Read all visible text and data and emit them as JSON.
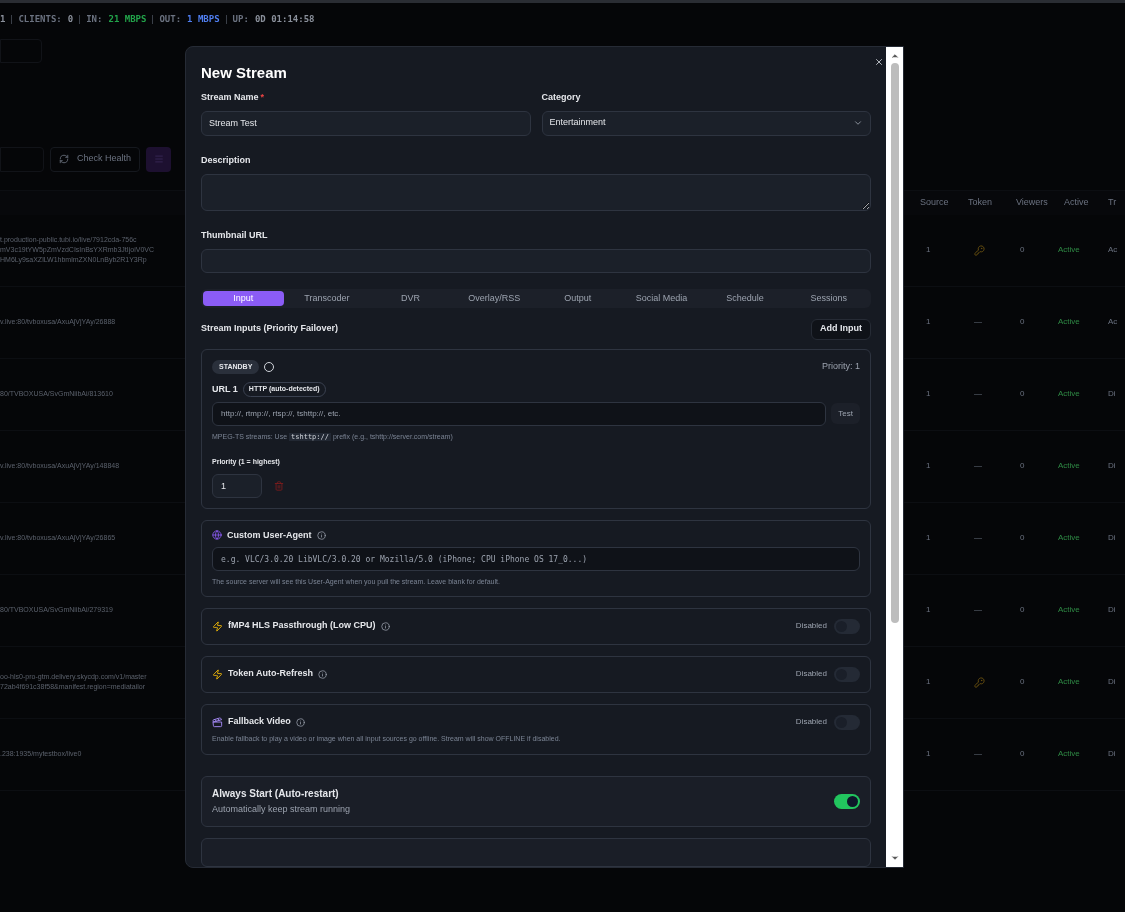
{
  "status_bar": [
    {
      "value": "1",
      "color": "#8b919c"
    },
    {
      "label": "CLIENTS:",
      "value": "0",
      "color": "#8b919c"
    },
    {
      "label": "IN:",
      "value": "21 MBPS",
      "color": "#22a34a"
    },
    {
      "label": "OUT:",
      "value": "1 MBPS",
      "color": "#4f7ef0"
    },
    {
      "label": "UP:",
      "value": "0D 01:14:58",
      "color": "#8b919c"
    }
  ],
  "toolbar": {
    "check_health": "Check Health"
  },
  "table": {
    "columns": [
      "Source",
      "Token",
      "Viewers",
      "Active",
      "Tr"
    ],
    "rows": [
      {
        "url": [
          "t.production-public.tubi.io/live/7912cda-756c",
          "mV3c19tYW5pZmVzdCIsInBsYXRmb3JtIjoiV0VC",
          "HM6Ly9saXZlLW1hbmlmZXN0LnByb2R1Y3Rp"
        ],
        "source": "1",
        "token": {
          "kind": "key"
        },
        "viewers": "0",
        "active": "Active",
        "column_6": "Ac"
      },
      {
        "url": [
          "v.live:80/tvboxusa/AxuAjVjYAy/26888"
        ],
        "source": "1",
        "token": {
          "kind": "none",
          "text": "—"
        },
        "viewers": "0",
        "active": "Active",
        "column_6": "Ac"
      },
      {
        "url": [
          "80/TVBOXUSA/SvGmNiibAi/813610"
        ],
        "source": "1",
        "token": {
          "kind": "none",
          "text": "—"
        },
        "viewers": "0",
        "active": "Active",
        "column_6": "Di"
      },
      {
        "url": [
          "v.live:80/tvboxusa/AxuAjVjYAy/148848"
        ],
        "source": "1",
        "token": {
          "kind": "none",
          "text": "—"
        },
        "viewers": "0",
        "active": "Active",
        "column_6": "Di"
      },
      {
        "url": [
          "v.live:80/tvboxusa/AxuAjVjYAy/26865"
        ],
        "source": "1",
        "token": {
          "kind": "none",
          "text": "—"
        },
        "viewers": "0",
        "active": "Active",
        "column_6": "Di"
      },
      {
        "url": [
          "80/TVBOXUSA/SvGmNiibAi/279319"
        ],
        "source": "1",
        "token": {
          "kind": "none",
          "text": "—"
        },
        "viewers": "0",
        "active": "Active",
        "column_6": "Di"
      },
      {
        "url": [
          "oo-hls0-pro-gtm.delivery.skycdp.com/v1/master",
          "72ab4f691c38f58&manifest.region=mediatailor"
        ],
        "source": "1",
        "token": {
          "kind": "key"
        },
        "viewers": "0",
        "active": "Active",
        "column_6": "Di"
      },
      {
        "url": [
          ".238:1935/mytestbox/live0"
        ],
        "source": "1",
        "token": {
          "kind": "none",
          "text": "—"
        },
        "viewers": "0",
        "active": "Active",
        "column_6": "Di"
      }
    ]
  },
  "modal": {
    "title": "New Stream",
    "stream_name": {
      "label": "Stream Name",
      "required": true,
      "required_mark": "*",
      "value": "Stream Test"
    },
    "category": {
      "label": "Category",
      "value": "Entertainment"
    },
    "description": {
      "label": "Description"
    },
    "thumbnail_url": {
      "label": "Thumbnail URL"
    },
    "tabs": [
      {
        "label": "Input",
        "selected": true
      },
      {
        "label": "Transcoder",
        "selected": false
      },
      {
        "label": "DVR",
        "selected": false
      },
      {
        "label": "Overlay/RSS",
        "selected": false
      },
      {
        "label": "Output",
        "selected": false
      },
      {
        "label": "Social Media",
        "selected": false
      },
      {
        "label": "Schedule",
        "selected": false
      },
      {
        "label": "Sessions",
        "selected": false
      }
    ],
    "inputs": {
      "title": "Stream Inputs (Priority Failover)",
      "add_button": "Add Input",
      "items": [
        {
          "status": "STANDBY",
          "priority_text": "Priority: 1",
          "url_label": "URL 1",
          "protocol": "HTTP (auto-detected)",
          "url_placeholder": "http://, rtmp://, rtsp://, tshttp://, etc.",
          "test_button": "Test",
          "hint_before": "MPEG-TS streams: Use",
          "hint_code": "tshttp://",
          "hint_after": "prefix (e.g., tshttp://server.com/stream)",
          "priority_label": "Priority (1 = highest)",
          "priority_value": "1"
        }
      ]
    },
    "user_agent": {
      "title": "Custom User-Agent",
      "placeholder": "e.g. VLC/3.0.20 LibVLC/3.0.20 or Mozilla/5.0 (iPhone; CPU iPhone OS 17_0...)",
      "hint": "The source server will see this User-Agent when you pull the stream. Leave blank for default."
    },
    "options": [
      {
        "kind": "bolt",
        "title": "fMP4 HLS Passthrough (Low CPU)",
        "status": "Disabled",
        "on": false
      },
      {
        "kind": "bolt",
        "title": "Token Auto-Refresh",
        "status": "Disabled",
        "on": false
      },
      {
        "kind": "film",
        "title": "Fallback Video",
        "status": "Disabled",
        "on": false,
        "description": "Enable fallback to play a video or image when all input sources go offline. Stream will show OFFLINE if disabled."
      }
    ],
    "always_start": {
      "title": "Always Start (Auto-restart)",
      "description": "Automatically keep stream running",
      "on": true
    }
  }
}
